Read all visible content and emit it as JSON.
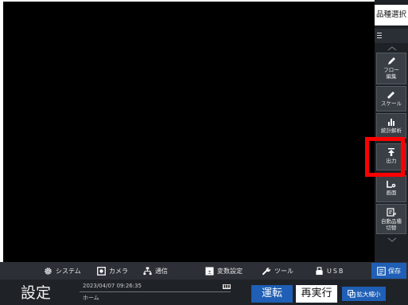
{
  "right_panel": {
    "product_select_label": "品種選択",
    "buttons": [
      {
        "label": "フロー\n編集",
        "icon": "pencil-icon"
      },
      {
        "label": "スケール",
        "icon": "ruler-icon"
      },
      {
        "label": "統計解析",
        "icon": "bar-chart-icon"
      },
      {
        "label": "出力",
        "icon": "upload-icon"
      },
      {
        "label": "画面",
        "icon": "screen-settings-icon"
      },
      {
        "label": "自動品種\n切替",
        "icon": "auto-switch-icon"
      }
    ]
  },
  "toolbar": {
    "items": [
      {
        "label": "システム",
        "icon": "gear-icon"
      },
      {
        "label": "カメラ",
        "icon": "camera-icon"
      },
      {
        "label": "通信",
        "icon": "network-icon"
      },
      {
        "label": "変数設定",
        "icon": "variable-icon"
      },
      {
        "label": "ツール",
        "icon": "wrench-icon"
      },
      {
        "label": "USB",
        "icon": "usb-icon"
      }
    ],
    "save_label": "保存"
  },
  "status": {
    "mode_title": "設定",
    "datetime": "2023/04/07 09:26:35",
    "screen_name": "ホーム"
  },
  "actions": {
    "run_label": "運転",
    "rerun_label": "再実行",
    "zoom_label": "拡大縮小"
  },
  "colors": {
    "accent": "#1f5fb5",
    "highlight": "#ff0000",
    "panel": "#1e2227"
  }
}
